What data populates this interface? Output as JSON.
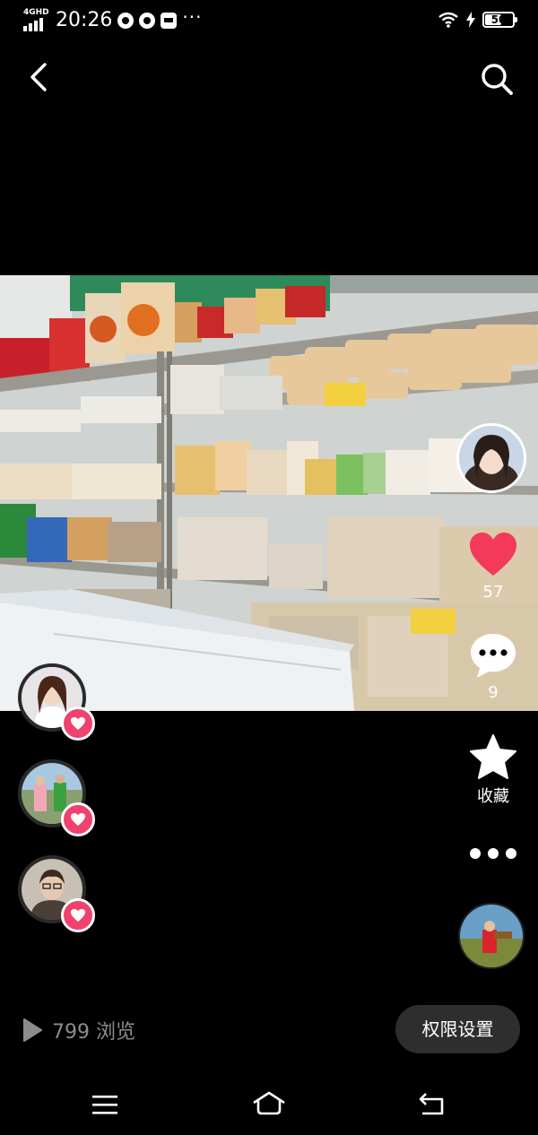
{
  "status_bar": {
    "network": "4GHD",
    "time": "20:26",
    "battery": "50",
    "more": "···"
  },
  "video": {
    "scene": "store-shelves-snacks"
  },
  "sidebar": {
    "like_count": "57",
    "comment_count": "9",
    "favorite_label": "收藏"
  },
  "likers": [
    {
      "avatar": "woman-portrait-avatar"
    },
    {
      "avatar": "couple-outdoor-avatar"
    },
    {
      "avatar": "woman-glasses-avatar"
    }
  ],
  "footer": {
    "views": "799 浏览",
    "permission_button": "权限设置"
  },
  "colors": {
    "like_red": "#f43a5a",
    "badge_pink": "#f0426e",
    "background": "#000000"
  }
}
